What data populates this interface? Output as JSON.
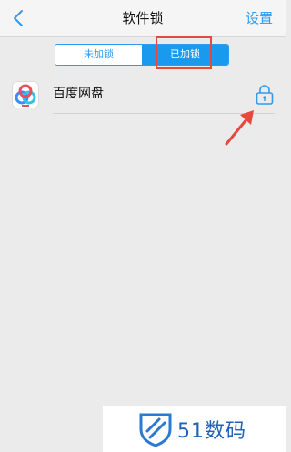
{
  "navbar": {
    "title": "软件锁",
    "settings_label": "设置",
    "back_icon": "chevron-left-icon"
  },
  "segment": {
    "tabs": [
      {
        "label": "未加锁",
        "selected": false
      },
      {
        "label": "已加锁",
        "selected": true
      }
    ]
  },
  "apps": [
    {
      "name": "百度网盘",
      "icon": "baidu-netdisk-icon",
      "locked": true,
      "lock_icon": "lock-icon"
    }
  ],
  "annotation": {
    "highlight_color": "#e8473d",
    "arrow_icon": "red-arrow-icon"
  },
  "watermark": {
    "text": "51数码",
    "logo": "shield-logo-icon"
  },
  "colors": {
    "accent": "#2f9bf0",
    "active_tab": "#1a9aef",
    "background": "#ebebeb",
    "brand_watermark": "#1e63b8"
  }
}
